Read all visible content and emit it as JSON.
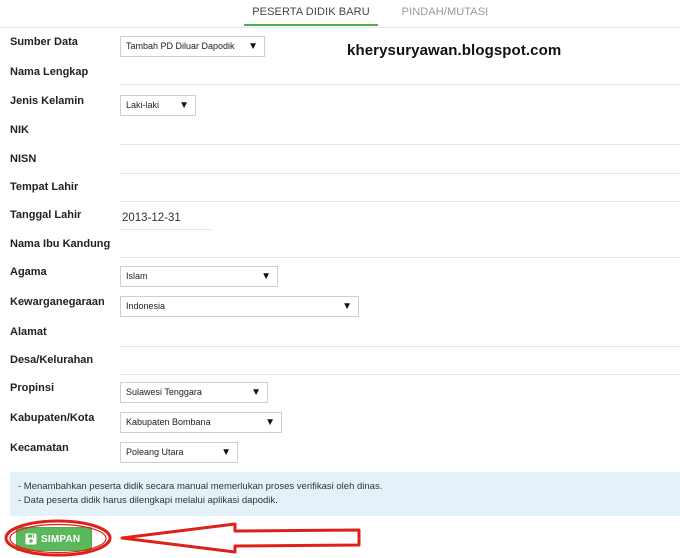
{
  "tabs": [
    {
      "label": "PESERTA DIDIK BARU",
      "active": true
    },
    {
      "label": "PINDAH/MUTASI",
      "active": false
    }
  ],
  "watermark": "kherysuryawan.blogspot.com",
  "form": {
    "sumber_data": {
      "label": "Sumber Data",
      "value": "Tambah PD Diluar Dapodik"
    },
    "nama_lengkap": {
      "label": "Nama Lengkap",
      "value": ""
    },
    "jenis_kelamin": {
      "label": "Jenis Kelamin",
      "value": "Laki-laki"
    },
    "nik": {
      "label": "NIK",
      "value": ""
    },
    "nisn": {
      "label": "NISN",
      "value": ""
    },
    "tempat_lahir": {
      "label": "Tempat Lahir",
      "value": ""
    },
    "tanggal_lahir": {
      "label": "Tanggal Lahir",
      "value": "2013-12-31"
    },
    "nama_ibu": {
      "label": "Nama Ibu Kandung",
      "value": ""
    },
    "agama": {
      "label": "Agama",
      "value": "Islam"
    },
    "kewarganegaraan": {
      "label": "Kewarganegaraan",
      "value": "Indonesia"
    },
    "alamat": {
      "label": "Alamat",
      "value": ""
    },
    "desa": {
      "label": "Desa/Kelurahan",
      "value": ""
    },
    "propinsi": {
      "label": "Propinsi",
      "value": "Sulawesi Tenggara"
    },
    "kabupaten": {
      "label": "Kabupaten/Kota",
      "value": "Kabupaten Bombana"
    },
    "kecamatan": {
      "label": "Kecamatan",
      "value": "Poleang Utara"
    }
  },
  "select_caret": "▼",
  "info": {
    "line1": "- Menambahkan peserta didik secara manual memerlukan proses verifikasi oleh dinas.",
    "line2": "- Data peserta didik harus dilengkapi melalui aplikasi dapodik."
  },
  "save_button": {
    "label": "SIMPAN",
    "icon": "floppy-disk-icon"
  },
  "colors": {
    "accent": "#5cb85c",
    "tab_underline": "#4caf50",
    "annotation": "#e0201b",
    "info_bg": "#e4f1f9"
  }
}
